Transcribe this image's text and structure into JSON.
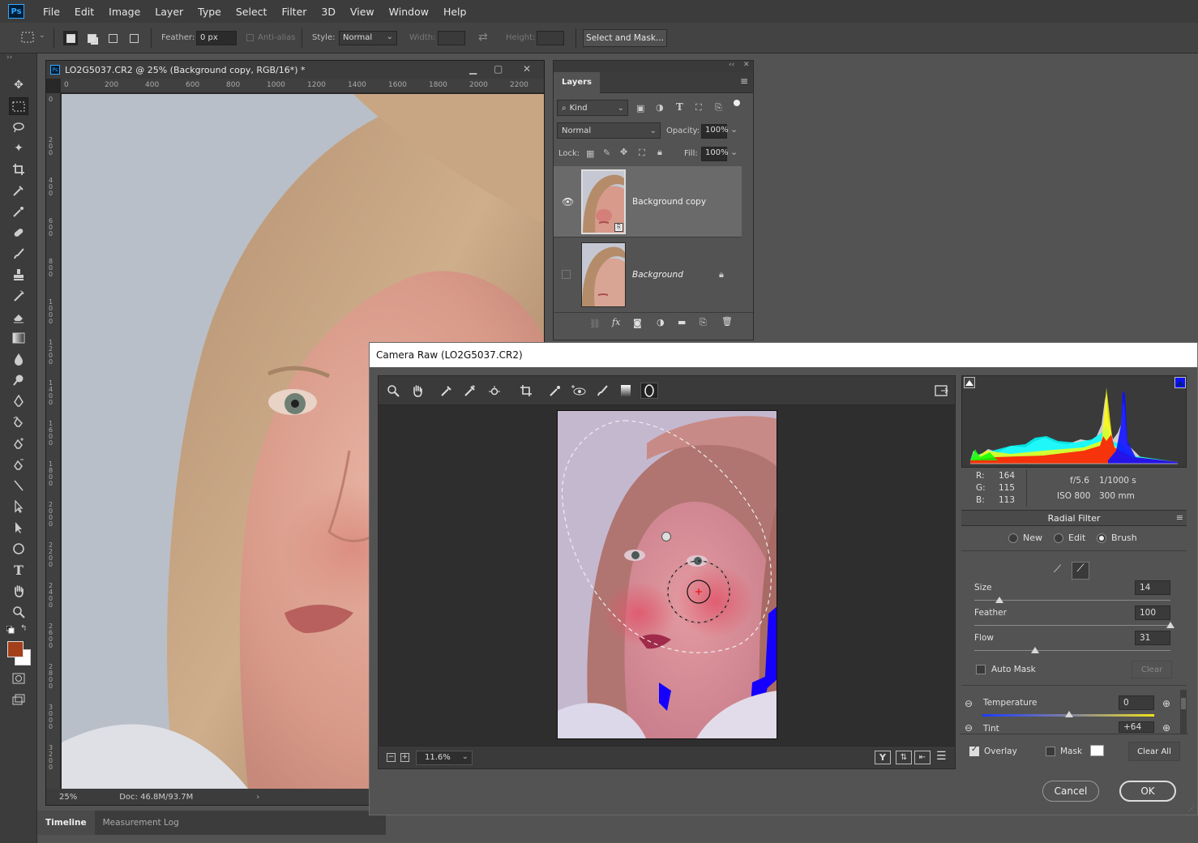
{
  "app": {
    "logo": "Ps"
  },
  "menu": [
    "File",
    "Edit",
    "Image",
    "Layer",
    "Type",
    "Select",
    "Filter",
    "3D",
    "View",
    "Window",
    "Help"
  ],
  "options": {
    "feather_label": "Feather:",
    "feather_value": "0 px",
    "antialias_label": "Anti-alias",
    "style_label": "Style:",
    "style_value": "Normal",
    "width_label": "Width:",
    "height_label": "Height:",
    "select_mask_label": "Select and Mask..."
  },
  "document": {
    "title": "LO2G5037.CR2 @ 25% (Background copy, RGB/16*) *",
    "ruler_h": [
      "0",
      "200",
      "400",
      "600",
      "800",
      "1000",
      "1200",
      "1400",
      "1600",
      "1800",
      "2000",
      "2200"
    ],
    "ruler_v": [
      "0",
      "200",
      "400",
      "600",
      "800",
      "1000",
      "1200",
      "1400",
      "1600",
      "1800",
      "2000",
      "2200",
      "2400",
      "2600",
      "2800",
      "3000",
      "3200"
    ],
    "zoom": "25%",
    "doc_info": "Doc: 46.8M/93.7M"
  },
  "bottom_tabs": [
    "Timeline",
    "Measurement Log"
  ],
  "layers_panel": {
    "tab": "Layers",
    "kind": "Kind",
    "blend": "Normal",
    "opacity_label": "Opacity:",
    "opacity": "100%",
    "lock_label": "Lock:",
    "fill_label": "Fill:",
    "fill": "100%",
    "layers": [
      {
        "name": "Background copy"
      },
      {
        "name": "Background"
      }
    ]
  },
  "camera_raw": {
    "title": "Camera Raw (LO2G5037.CR2)",
    "zoom": "11.6%",
    "rgb": {
      "r_label": "R:",
      "r": "164",
      "g_label": "G:",
      "g": "115",
      "b_label": "B:",
      "b": "113"
    },
    "exif": {
      "aperture": "f/5.6",
      "shutter": "1/1000 s",
      "iso": "ISO 800",
      "focal": "300 mm"
    },
    "panel_title": "Radial Filter",
    "modes": [
      "New",
      "Edit",
      "Brush"
    ],
    "brush": {
      "size_label": "Size",
      "size": "14",
      "size_pct": 13,
      "feather_label": "Feather",
      "feather": "100",
      "feather_pct": 100,
      "flow_label": "Flow",
      "flow": "31",
      "flow_pct": 31
    },
    "auto_mask": "Auto Mask",
    "clear": "Clear",
    "temp_label": "Temperature",
    "temp": "0",
    "tint_label": "Tint",
    "tint": "+64",
    "overlay": "Overlay",
    "mask": "Mask",
    "clear_all": "Clear All",
    "cancel": "Cancel",
    "ok": "OK"
  }
}
